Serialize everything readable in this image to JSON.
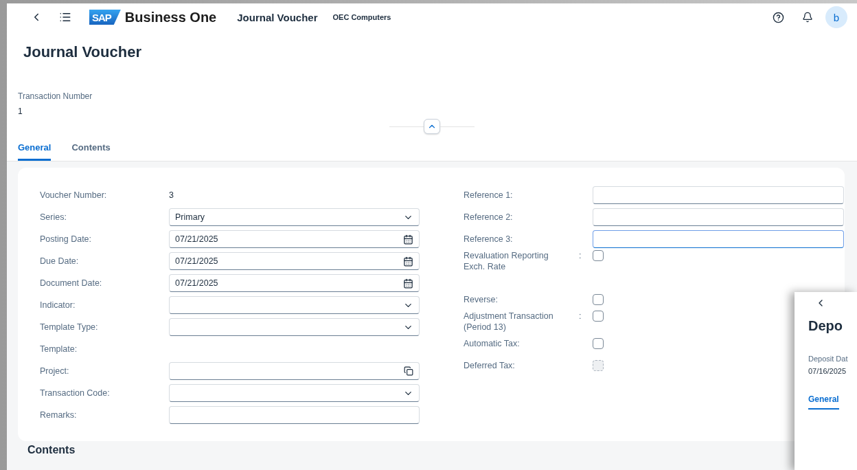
{
  "header": {
    "logo": "SAP",
    "product": "Business One",
    "app_title": "Journal Voucher",
    "company": "OEC Computers",
    "avatar": "b"
  },
  "page_title": "Journal Voucher",
  "transaction": {
    "label": "Transaction Number",
    "value": "1"
  },
  "tabs": [
    {
      "label": "General",
      "selected": true
    },
    {
      "label": "Contents",
      "selected": false
    }
  ],
  "form": {
    "left": [
      {
        "kind": "text",
        "label": "Voucher Number:",
        "value": "3"
      },
      {
        "kind": "select",
        "label": "Series:",
        "value": "Primary"
      },
      {
        "kind": "date",
        "label": "Posting Date:",
        "value": "07/21/2025"
      },
      {
        "kind": "date",
        "label": "Due Date:",
        "value": "07/21/2025"
      },
      {
        "kind": "date",
        "label": "Document Date:",
        "value": "07/21/2025"
      },
      {
        "kind": "select",
        "label": "Indicator:"
      },
      {
        "kind": "select",
        "label": "Template Type:"
      },
      {
        "kind": "label",
        "label": "Template:"
      },
      {
        "kind": "valuehelp",
        "label": "Project:"
      },
      {
        "kind": "select",
        "label": "Transaction Code:"
      },
      {
        "kind": "input",
        "label": "Remarks:"
      }
    ],
    "right": [
      {
        "kind": "input",
        "label": "Reference 1:",
        "focused": false
      },
      {
        "kind": "input",
        "label": "Reference 2:",
        "focused": false
      },
      {
        "kind": "input",
        "label": "Reference 3:",
        "focused": true
      },
      {
        "kind": "checkbox",
        "label": "Revaluation Reporting Exch. Rate",
        "separator": ":",
        "checked": false,
        "disabled": false
      },
      {
        "kind": "checkbox",
        "label": "Reverse:",
        "checked": false,
        "disabled": false
      },
      {
        "kind": "checkbox",
        "label": "Adjustment Transaction (Period 13)",
        "separator": ":",
        "checked": false,
        "disabled": false
      },
      {
        "kind": "checkbox",
        "label": "Automatic Tax:",
        "checked": false,
        "disabled": false
      },
      {
        "kind": "checkbox",
        "label": "Deferred Tax:",
        "checked": false,
        "disabled": true
      }
    ]
  },
  "section_heading": "Contents",
  "overlay_window": {
    "title": "Depo",
    "field_label": "Deposit Dat",
    "field_value": "07/16/2025",
    "tabs": [
      {
        "label": "General",
        "selected": true
      }
    ]
  }
}
